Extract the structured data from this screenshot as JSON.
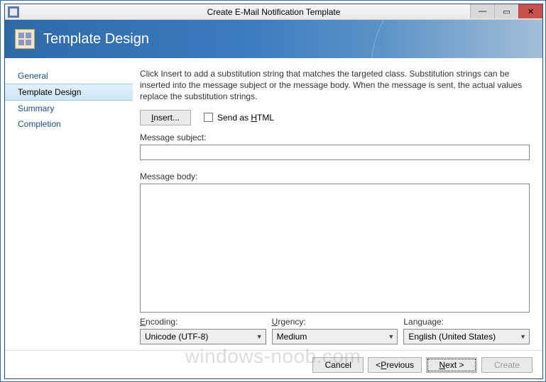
{
  "window": {
    "title": "Create E-Mail Notification Template"
  },
  "header": {
    "title": "Template Design"
  },
  "sidebar": {
    "items": [
      {
        "label": "General"
      },
      {
        "label": "Template Design"
      },
      {
        "label": "Summary"
      },
      {
        "label": "Completion"
      }
    ],
    "active_index": 1
  },
  "content": {
    "instructions": "Click Insert to add a substitution string that matches the targeted class. Substitution strings can be inserted into the message subject or the message body. When the message is sent, the actual values replace the substitution strings.",
    "insert_button": "Insert...",
    "send_html_label": "Send as HTML",
    "send_html_checked": false,
    "subject_label": "Message subject:",
    "subject_value": "",
    "body_label": "Message body:",
    "body_value": "",
    "encoding_label": "Encoding:",
    "encoding_value": "Unicode (UTF-8)",
    "urgency_label": "Urgency:",
    "urgency_value": "Medium",
    "language_label": "Language:",
    "language_value": "English (United States)"
  },
  "footer": {
    "cancel": "Cancel",
    "previous": "< Previous",
    "next": "Next >",
    "create": "Create"
  },
  "watermark": "windows-noob.com"
}
